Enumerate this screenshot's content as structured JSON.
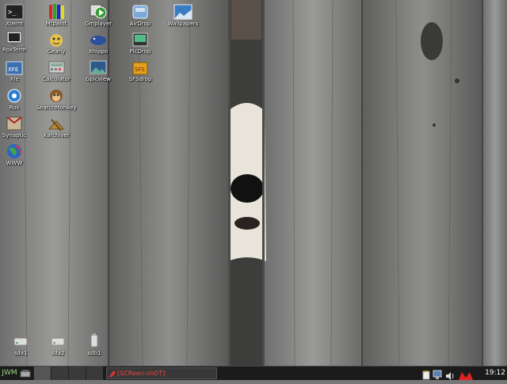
{
  "desktop": {
    "icons": [
      {
        "label": "Xterm",
        "icon": "terminal-icon"
      },
      {
        "label": "RoxTerm",
        "icon": "terminal-icon"
      },
      {
        "label": "Xfe",
        "icon": "file-manager-icon"
      },
      {
        "label": "Rox",
        "icon": "gear-icon"
      },
      {
        "label": "Synaptic",
        "icon": "package-manager-icon"
      },
      {
        "label": "WWW",
        "icon": "globe-icon"
      },
      {
        "label": "Mtpaint",
        "icon": "pencils-icon"
      },
      {
        "label": "Geany",
        "icon": "editor-icon"
      },
      {
        "label": "Calculator",
        "icon": "calculator-icon"
      },
      {
        "label": "SearchMonkey",
        "icon": "monkey-icon"
      },
      {
        "label": "Xarchiver",
        "icon": "archive-icon"
      },
      {
        "label": "Gmplayer",
        "icon": "media-player-icon"
      },
      {
        "label": "Xhippo",
        "icon": "hippo-icon"
      },
      {
        "label": "Gpicview",
        "icon": "image-viewer-icon"
      },
      {
        "label": "AirDrop",
        "icon": "airdrop-icon"
      },
      {
        "label": "PicDrop",
        "icon": "picdrop-icon"
      },
      {
        "label": "SFSdrop",
        "icon": "sfs-icon"
      },
      {
        "label": "Wallpapers",
        "icon": "wallpapers-icon"
      }
    ],
    "drives": [
      {
        "label": "sda1",
        "icon": "drive-icon"
      },
      {
        "label": "sda2",
        "icon": "drive-icon"
      },
      {
        "label": "sdb1",
        "icon": "usb-drive-icon"
      }
    ]
  },
  "taskbar": {
    "menu_label": "JWM",
    "task_title": "[SCReen-shOT]",
    "clock": "19:12",
    "tray_icons": [
      "clipboard-icon",
      "network-icon",
      "volume-icon",
      "battery-icon"
    ]
  },
  "colors": {
    "taskbar_bg": "#1b1b1b",
    "clock_text": "#ffffff",
    "task_title_text": "#ee4444",
    "menu_text": "#9ad58a"
  }
}
